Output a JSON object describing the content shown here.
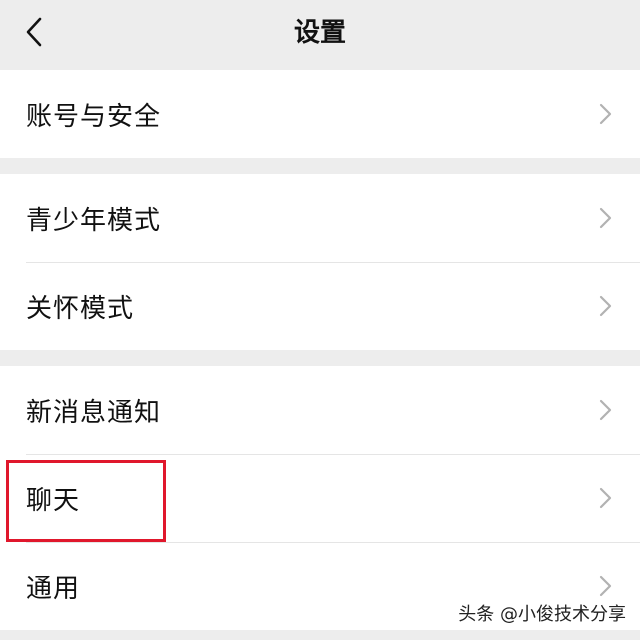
{
  "header": {
    "title": "设置"
  },
  "groups": [
    {
      "items": [
        {
          "label": "账号与安全"
        }
      ]
    },
    {
      "items": [
        {
          "label": "青少年模式"
        },
        {
          "label": "关怀模式"
        }
      ]
    },
    {
      "items": [
        {
          "label": "新消息通知"
        },
        {
          "label": "聊天"
        },
        {
          "label": "通用"
        }
      ]
    }
  ],
  "highlight_color": "#e0172c",
  "watermark": "头条 @小俊技术分享",
  "icons": {
    "back": "back-arrow-icon",
    "row": "chevron-right-icon"
  }
}
